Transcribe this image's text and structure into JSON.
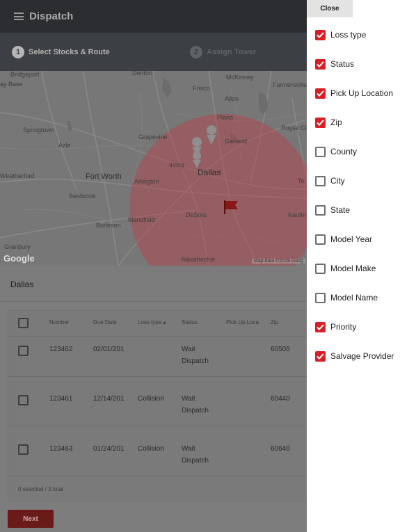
{
  "header": {
    "title": "Dispatch"
  },
  "stepper": {
    "steps": [
      {
        "number": "1",
        "label": "Select Stocks & Route"
      },
      {
        "number": "2",
        "label": "Assign Tower"
      }
    ]
  },
  "map": {
    "labels": [
      "Bridgeport",
      "ay Base",
      "Denton",
      "McKinney",
      "Frisco",
      "Farmersville",
      "Allen",
      "Springtown",
      "Plano",
      "Royse Cit",
      "Azle",
      "Grapevine",
      "Garland",
      "Irving",
      "Dallas",
      "Weatherford",
      "Fort Worth",
      "Arlington",
      "Benbrook",
      "DeSoto",
      "Kaufm",
      "Mansfield",
      "Burleson",
      "Granbury",
      "Waxahachie",
      "Te"
    ],
    "copyright": "Map data ©2019 Goog",
    "logo": "Google"
  },
  "location": {
    "value": "Dallas"
  },
  "table": {
    "columns": [
      "Number",
      "Due Date",
      "Loss type",
      "Status",
      "Pick Up Loca",
      "Zip"
    ],
    "sort_indicator": "▴",
    "rows": [
      {
        "number": "123462",
        "due_date": "02/01/201",
        "loss_type": "",
        "status_line1": "Wait",
        "status_line2": "Dispatch",
        "zip": "60505"
      },
      {
        "number": "123461",
        "due_date": "12/14/201",
        "loss_type": "Collision",
        "status_line1": "Wait",
        "status_line2": "Dispatch",
        "zip": "60440"
      },
      {
        "number": "123463",
        "due_date": "01/24/201",
        "loss_type": "Collision",
        "status_line1": "Wait",
        "status_line2": "Dispatch",
        "zip": "60640"
      }
    ],
    "footer": "0 selected / 3 total"
  },
  "actions": {
    "next_label": "Next"
  },
  "column_panel": {
    "close_label": "Close",
    "options": [
      {
        "label": "Loss type",
        "checked": true
      },
      {
        "label": "Status",
        "checked": true
      },
      {
        "label": "Pick Up Location",
        "checked": true
      },
      {
        "label": "Zip",
        "checked": true
      },
      {
        "label": "County",
        "checked": false
      },
      {
        "label": "City",
        "checked": false
      },
      {
        "label": "State",
        "checked": false
      },
      {
        "label": "Model Year",
        "checked": false
      },
      {
        "label": "Model Make",
        "checked": false
      },
      {
        "label": "Model Name",
        "checked": false
      },
      {
        "label": "Priority",
        "checked": true
      },
      {
        "label": "Salvage Provider",
        "checked": true
      }
    ]
  },
  "colors": {
    "accent": "#d61f26",
    "header_bg": "#2b2d30",
    "overlay_gray": "#7d7d7d",
    "next_button": "#6b1a1a"
  }
}
